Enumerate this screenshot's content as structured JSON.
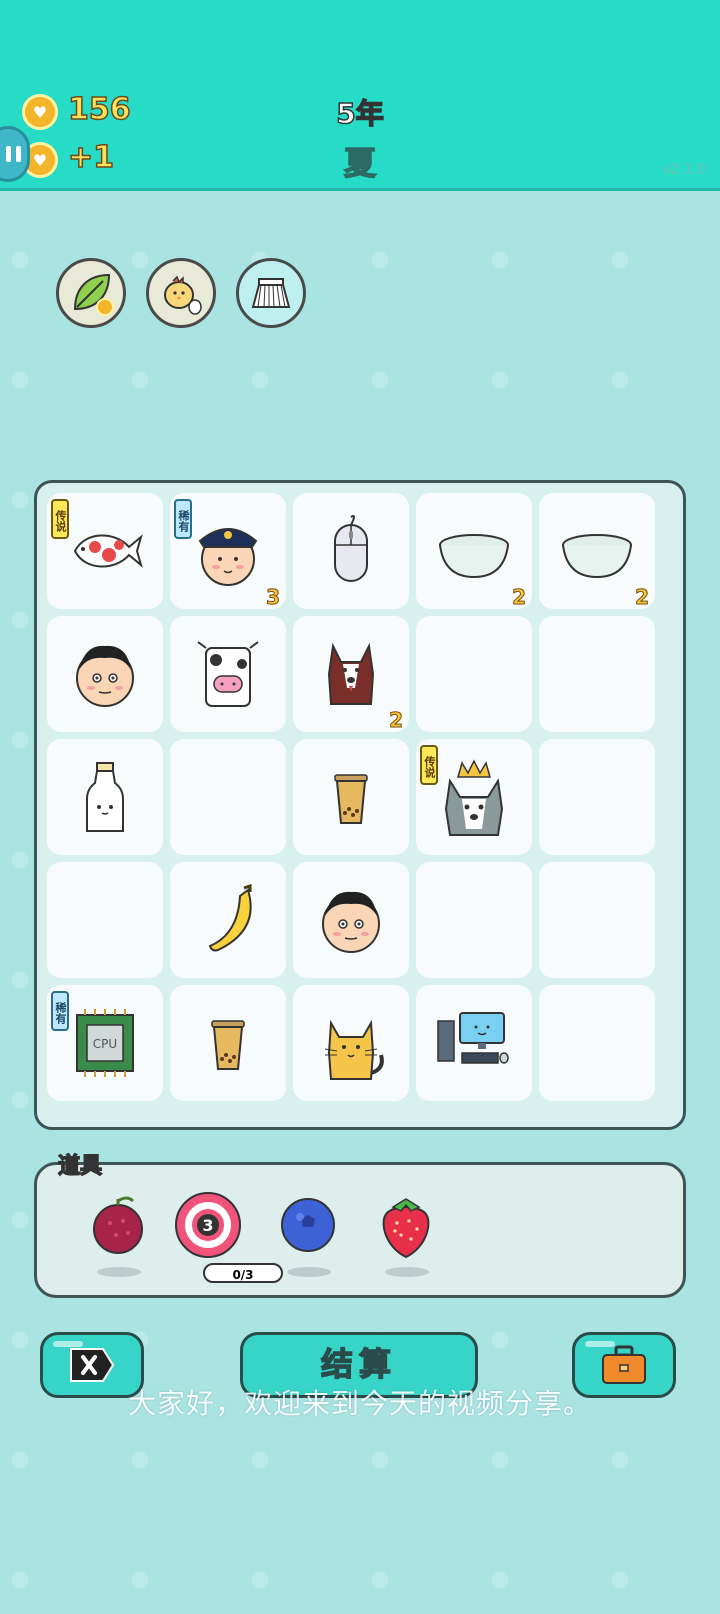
{
  "header": {
    "coins": "156",
    "coin_rate": "+1",
    "year": "5年",
    "season": "夏",
    "version": "v2.1.0"
  },
  "top_tools": [
    {
      "icon": "leaf-icon"
    },
    {
      "icon": "chick-icon"
    },
    {
      "icon": "skirt-icon"
    }
  ],
  "board": {
    "cells": [
      {
        "icon": "koi-fish-icon",
        "tag": "传说",
        "count": ""
      },
      {
        "icon": "police-officer-icon",
        "tag": "稀有",
        "count": "3"
      },
      {
        "icon": "computer-mouse-icon",
        "tag": "",
        "count": ""
      },
      {
        "icon": "bowl-icon",
        "tag": "",
        "count": "2"
      },
      {
        "icon": "bowl-icon",
        "tag": "",
        "count": "2"
      },
      {
        "icon": "man-face-icon",
        "tag": "",
        "count": ""
      },
      {
        "icon": "cow-icon",
        "tag": "",
        "count": ""
      },
      {
        "icon": "husky-dog-icon",
        "tag": "",
        "count": "2"
      },
      {
        "icon": "",
        "tag": "",
        "count": ""
      },
      {
        "icon": "",
        "tag": "",
        "count": ""
      },
      {
        "icon": "milk-bottle-icon",
        "tag": "",
        "count": ""
      },
      {
        "icon": "",
        "tag": "",
        "count": ""
      },
      {
        "icon": "bubble-tea-icon",
        "tag": "",
        "count": ""
      },
      {
        "icon": "husky-king-icon",
        "tag": "传说",
        "count": ""
      },
      {
        "icon": "",
        "tag": "",
        "count": ""
      },
      {
        "icon": "",
        "tag": "",
        "count": ""
      },
      {
        "icon": "banana-icon",
        "tag": "",
        "count": ""
      },
      {
        "icon": "man-face-icon",
        "tag": "",
        "count": ""
      },
      {
        "icon": "",
        "tag": "",
        "count": ""
      },
      {
        "icon": "",
        "tag": "",
        "count": ""
      },
      {
        "icon": "cpu-chip-icon",
        "tag": "稀有",
        "count": ""
      },
      {
        "icon": "bubble-tea-icon",
        "tag": "",
        "count": ""
      },
      {
        "icon": "cat-icon",
        "tag": "",
        "count": ""
      },
      {
        "icon": "desktop-computer-icon",
        "tag": "",
        "count": ""
      },
      {
        "icon": "",
        "tag": "",
        "count": ""
      }
    ]
  },
  "items": {
    "label": "道具",
    "list": [
      {
        "icon": "lychee-icon"
      },
      {
        "icon": "target-icon",
        "badge": "3",
        "progress": "0/3"
      },
      {
        "icon": "blueberry-icon"
      },
      {
        "icon": "strawberry-icon"
      }
    ]
  },
  "buttons": {
    "settle_label": "结算"
  },
  "subtitle": "大家好，欢迎来到今天的视频分享。",
  "colors": {
    "header": "#27dcc6",
    "background": "#a9e4e3",
    "button": "#36d5c7",
    "count_text": "#f7c63a"
  }
}
